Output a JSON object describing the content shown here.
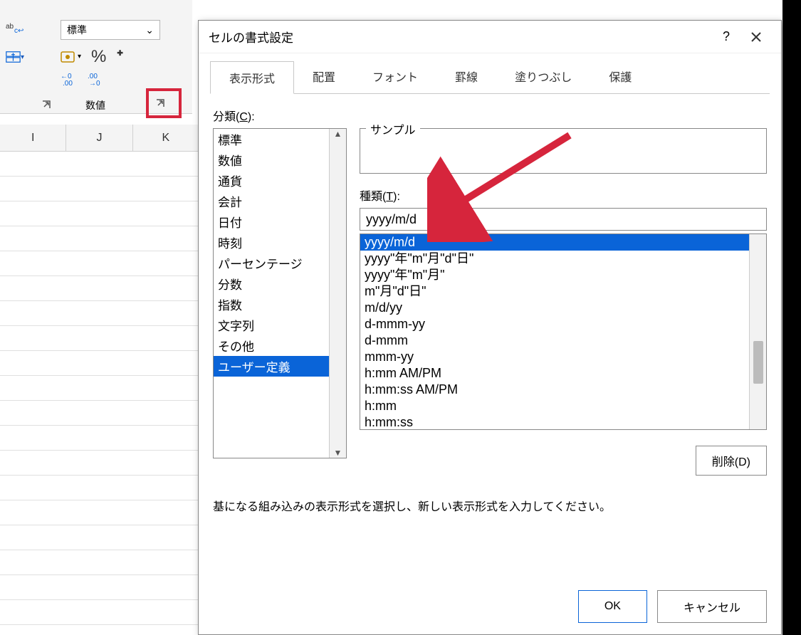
{
  "ribbon": {
    "number_format_selected": "標準",
    "section_label": "数値"
  },
  "grid": {
    "columns": [
      "I",
      "J",
      "K"
    ]
  },
  "dialog": {
    "title": "セルの書式設定",
    "tabs": [
      "表示形式",
      "配置",
      "フォント",
      "罫線",
      "塗りつぶし",
      "保護"
    ],
    "active_tab_index": 0,
    "category_label": "分類(",
    "category_key": "C",
    "category_label_suffix": "):",
    "categories": [
      "標準",
      "数値",
      "通貨",
      "会計",
      "日付",
      "時刻",
      "パーセンテージ",
      "分数",
      "指数",
      "文字列",
      "その他",
      "ユーザー定義"
    ],
    "selected_category_index": 11,
    "sample_label": "サンプル",
    "type_label": "種類(",
    "type_key": "T",
    "type_label_suffix": "):",
    "type_value": "yyyy/m/d",
    "type_options": [
      "yyyy/m/d",
      "yyyy\"年\"m\"月\"d\"日\"",
      "yyyy\"年\"m\"月\"",
      "m\"月\"d\"日\"",
      "m/d/yy",
      "d-mmm-yy",
      "d-mmm",
      "mmm-yy",
      "h:mm AM/PM",
      "h:mm:ss AM/PM",
      "h:mm",
      "h:mm:ss"
    ],
    "selected_type_index": 0,
    "delete_label": "削除(D)",
    "hint": "基になる組み込みの表示形式を選択し、新しい表示形式を入力してください。",
    "ok_label": "OK",
    "cancel_label": "キャンセル"
  }
}
